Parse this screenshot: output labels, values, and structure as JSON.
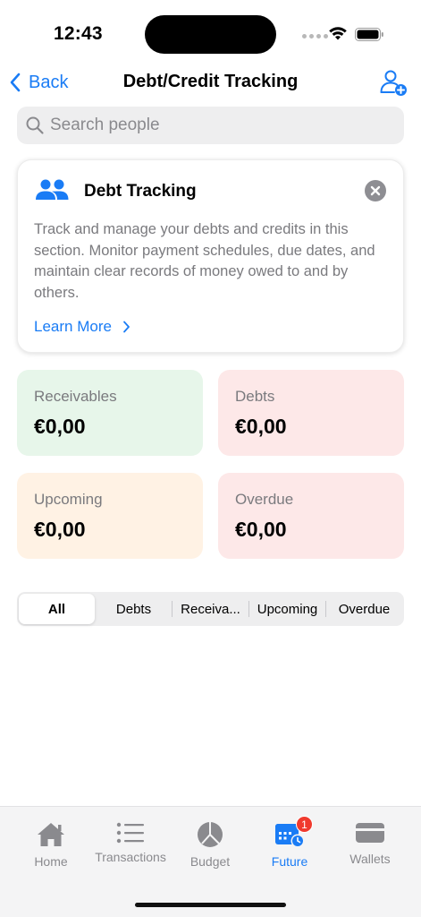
{
  "status": {
    "time": "12:43"
  },
  "nav": {
    "back_label": "Back",
    "title": "Debt/Credit Tracking"
  },
  "search": {
    "placeholder": "Search people",
    "value": ""
  },
  "info_card": {
    "title": "Debt Tracking",
    "body": "Track and manage your debts and credits in this section. Monitor payment schedules, due dates, and maintain clear records of money owed to and by others.",
    "learn_more": "Learn More"
  },
  "stats": [
    {
      "label": "Receivables",
      "value": "€0,00",
      "color": "#e7f6ea"
    },
    {
      "label": "Debts",
      "value": "€0,00",
      "color": "#fde8e8"
    },
    {
      "label": "Upcoming",
      "value": "€0,00",
      "color": "#fff2e4"
    },
    {
      "label": "Overdue",
      "value": "€0,00",
      "color": "#fde8e8"
    }
  ],
  "filter_tabs": [
    {
      "label": "All",
      "selected": true
    },
    {
      "label": "Debts",
      "selected": false
    },
    {
      "label": "Receiva...",
      "selected": false
    },
    {
      "label": "Upcoming",
      "selected": false
    },
    {
      "label": "Overdue",
      "selected": false
    }
  ],
  "tabbar": {
    "items": [
      {
        "label": "Home",
        "icon": "house-icon"
      },
      {
        "label": "Transactions",
        "icon": "list-icon"
      },
      {
        "label": "Budget",
        "icon": "pie-chart-icon"
      },
      {
        "label": "Future",
        "icon": "calendar-clock-icon",
        "badge": "1",
        "active": true
      },
      {
        "label": "Wallets",
        "icon": "wallet-icon"
      }
    ]
  },
  "colors": {
    "accent": "#1a7cf5",
    "badge": "#f03a2e"
  }
}
